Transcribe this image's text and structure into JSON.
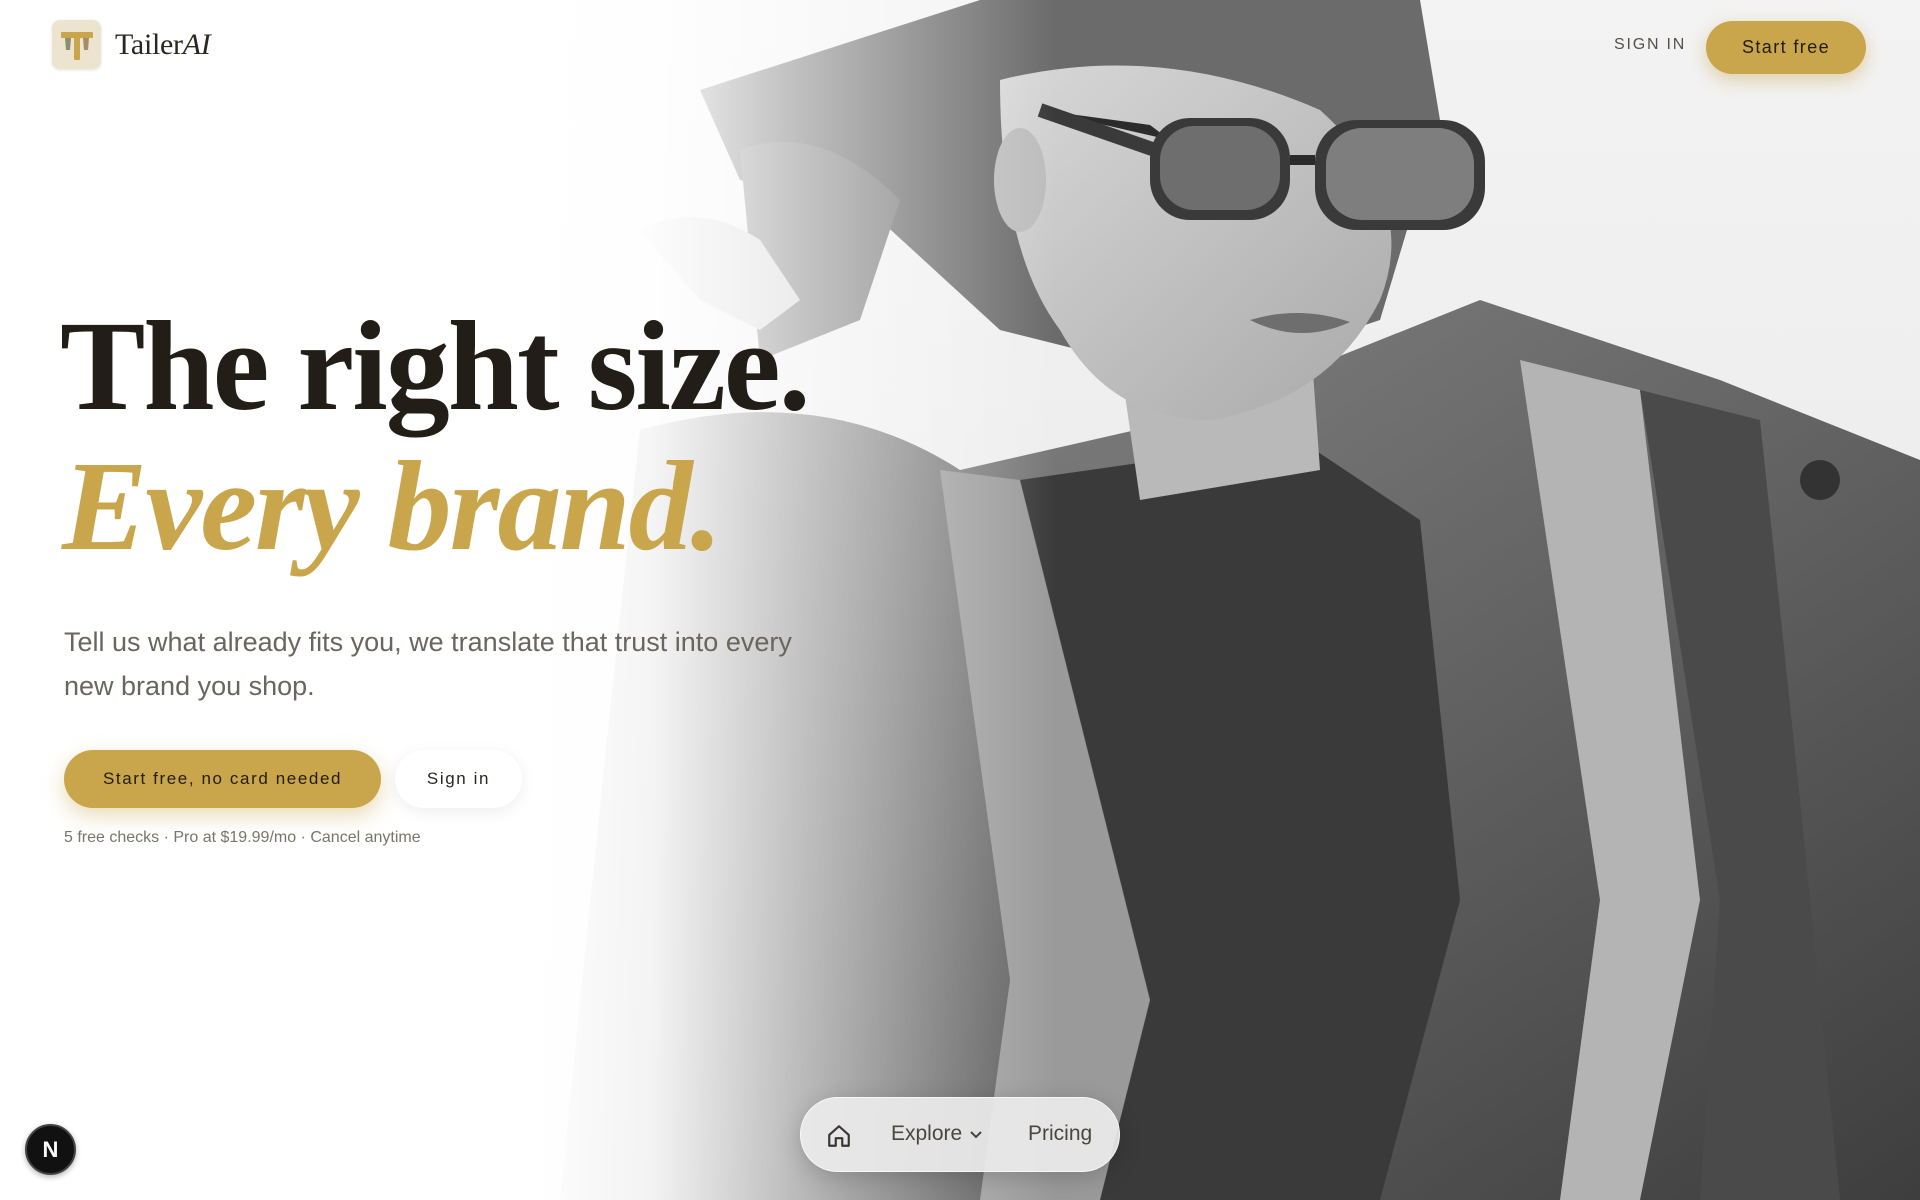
{
  "brand": {
    "name": "Tailer",
    "name_suffix": "AI",
    "logo_icon": "tailor-t-icon"
  },
  "nav": {
    "sign_in": "SIGN IN",
    "start_free": "Start free"
  },
  "hero": {
    "headline_line1": "The right size.",
    "headline_line2": "Every brand.",
    "subcopy": "Tell us what already fits you, we translate that trust into every new brand you shop.",
    "primary_cta": "Start free, no card needed",
    "secondary_cta": "Sign in",
    "fineprint": "5 free checks · Pro at $19.99/mo · Cancel anytime"
  },
  "bottom_nav": {
    "home_icon": "home-icon",
    "explore": "Explore",
    "pricing": "Pricing"
  },
  "dev_badge": {
    "label": "N"
  },
  "colors": {
    "accent": "#c9a54b",
    "text_dark": "#221e17",
    "text_muted": "#6a655e"
  }
}
